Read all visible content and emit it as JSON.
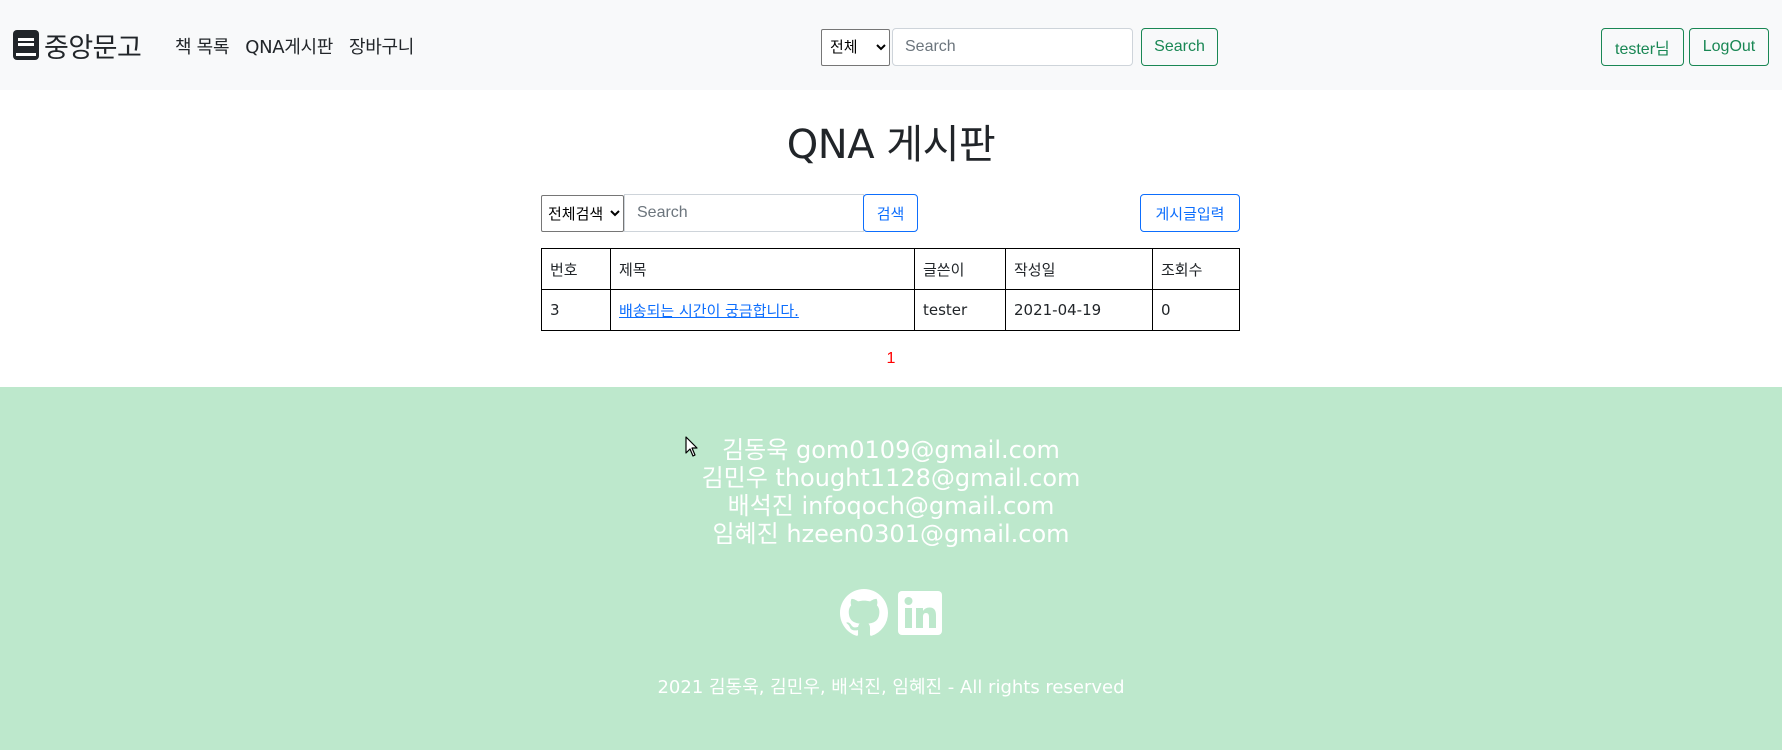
{
  "navbar": {
    "brand": "중앙문고",
    "links": [
      "책 목록",
      "QNA게시판",
      "장바구니"
    ],
    "search": {
      "select_value": "전체",
      "placeholder": "Search",
      "button": "Search"
    },
    "user": {
      "user_button": "tester님",
      "logout_button": "LogOut"
    }
  },
  "page": {
    "title": "QNA 게시판"
  },
  "board": {
    "search_select_value": "전체검색",
    "search_placeholder": "Search",
    "search_button": "검색",
    "write_button": "게시글입력",
    "columns": [
      "번호",
      "제목",
      "글쓴이",
      "작성일",
      "조회수"
    ],
    "rows": [
      {
        "no": "3",
        "title": "배송되는 시간이 궁금합니다.",
        "author": "tester",
        "date": "2021-04-19",
        "views": "0"
      }
    ],
    "pagination": [
      "1"
    ]
  },
  "footer": {
    "contacts": [
      "김동욱 gom0109@gmail.com",
      "김민우 thought1128@gmail.com",
      "배석진 infoqoch@gmail.com",
      "임혜진 hzeen0301@gmail.com"
    ],
    "social_icons": [
      "github-icon",
      "linkedin-icon"
    ],
    "copyright": "2021 김동욱, 김민우, 배석진, 임혜진 - All rights reserved"
  },
  "colors": {
    "navbar_bg": "#f8f9fa",
    "success": "#198754",
    "primary": "#0d6efd",
    "footer_bg": "#bde8cc",
    "page_active": "#ff0000"
  }
}
